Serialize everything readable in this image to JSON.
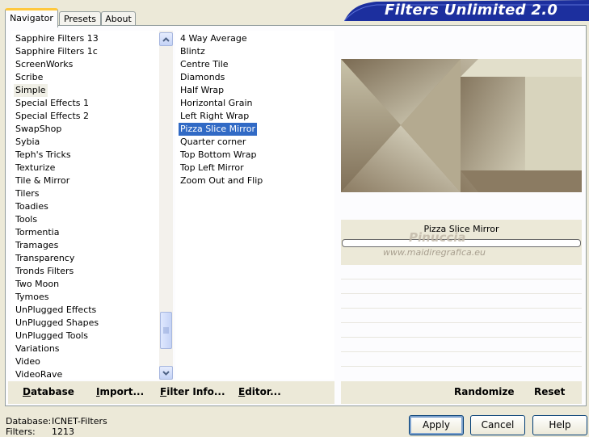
{
  "tabs": [
    "Navigator",
    "Presets",
    "About"
  ],
  "app_title": "Filters Unlimited 2.0",
  "categories": [
    "Sapphire Filters 13",
    "Sapphire Filters 1c",
    "ScreenWorks",
    "Scribe",
    "Simple",
    "Special Effects 1",
    "Special Effects 2",
    "SwapShop",
    "Sybia",
    "Teph's Tricks",
    "Texturize",
    "Tile & Mirror",
    "Tilers",
    "Toadies",
    "Tools",
    "Tormentia",
    "Tramages",
    "Transparency",
    "Tronds Filters",
    "Two Moon",
    "Tymoes",
    "UnPlugged Effects",
    "UnPlugged Shapes",
    "UnPlugged Tools",
    "Variations",
    "Video",
    "VideoRave"
  ],
  "selected_category": "Simple",
  "filters": [
    "4 Way Average",
    "Blintz",
    "Centre Tile",
    "Diamonds",
    "Half Wrap",
    "Horizontal Grain",
    "Left Right Wrap",
    "Pizza Slice Mirror",
    "Quarter corner",
    "Top Bottom Wrap",
    "Top Left Mirror",
    "Zoom Out and Flip"
  ],
  "selected_filter": "Pizza Slice Mirror",
  "preview_label": "Pizza Slice Mirror",
  "watermark": {
    "line1": "Pinuccia",
    "line2": "www.maidiregrafica.eu"
  },
  "bottom_buttons": {
    "database": "Database",
    "import": "Import...",
    "filter_info": "Filter Info...",
    "editor": "Editor...",
    "randomize": "Randomize",
    "reset": "Reset"
  },
  "footer": {
    "database_label": "Database:",
    "database_value": "ICNET-Filters",
    "filters_label": "Filters:",
    "filters_value": "1213"
  },
  "dialog_buttons": {
    "apply": "Apply",
    "cancel": "Cancel",
    "help": "Help"
  },
  "colors": {
    "banner": "#1c2f9e",
    "selection": "#316ac5",
    "preview_dark": "#8b7b62",
    "preview_light": "#dcd8c4"
  }
}
